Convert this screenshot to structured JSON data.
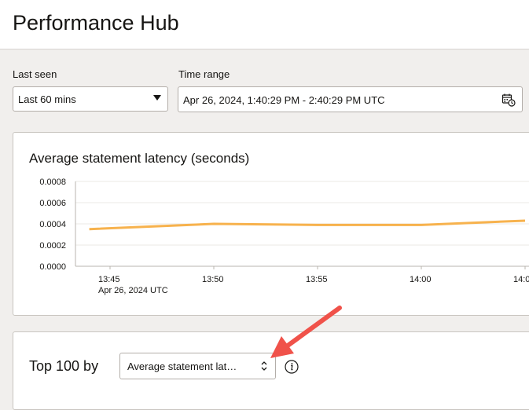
{
  "header": {
    "title": "Performance Hub"
  },
  "filters": {
    "last_seen_label": "Last seen",
    "last_seen_value": "Last 60 mins",
    "time_range_label": "Time range",
    "time_range_value": "Apr 26, 2024, 1:40:29 PM - 2:40:29 PM UTC"
  },
  "chart_card": {
    "title": "Average statement latency (seconds)"
  },
  "chart_data": {
    "type": "line",
    "title": "Average statement latency (seconds)",
    "xlabel": "",
    "ylabel": "",
    "ylim": [
      0,
      0.0008
    ],
    "yticks": [
      "0.0008",
      "0.0006",
      "0.0004",
      "0.0002",
      "0.0000"
    ],
    "xticks": [
      "13:45",
      "13:50",
      "13:55",
      "14:00",
      "14:0"
    ],
    "xtick_sublabel": "Apr 26, 2024 UTC",
    "grid": true,
    "series": [
      {
        "color": "#f7b24d",
        "x": [
          "13:44",
          "13:50",
          "13:55",
          "14:00",
          "14:05"
        ],
        "values": [
          0.00035,
          0.0004,
          0.00039,
          0.00039,
          0.00043
        ]
      }
    ]
  },
  "top_card": {
    "label": "Top 100 by",
    "metric_value": "Average statement lat…"
  },
  "colors": {
    "line": "#f7b24d",
    "annotation_arrow": "#f0524a"
  },
  "icons": {
    "calendar": "calendar-clock-icon",
    "dropdown": "chevron-down-icon",
    "updown": "chevron-up-down-icon",
    "info": "info-icon"
  }
}
